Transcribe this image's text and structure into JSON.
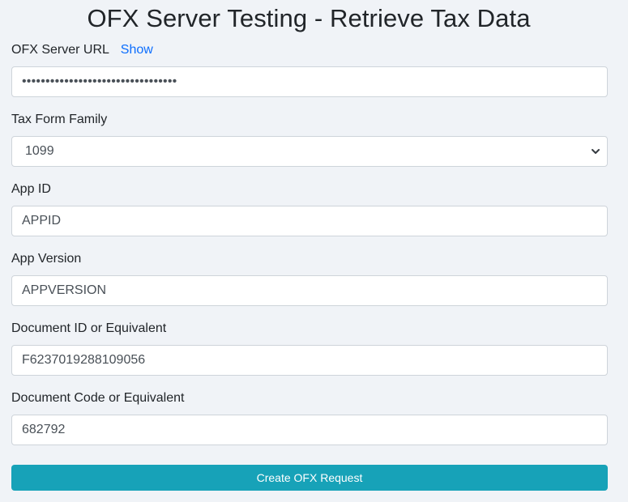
{
  "page": {
    "title": "OFX Server Testing - Retrieve Tax Data"
  },
  "form": {
    "server_url": {
      "label": "OFX Server URL",
      "toggle_label": "Show",
      "value": "•••••••••••••••••••••••••••••••••"
    },
    "tax_form_family": {
      "label": "Tax Form Family",
      "selected": "1099"
    },
    "app_id": {
      "label": "App ID",
      "value": "APPID"
    },
    "app_version": {
      "label": "App Version",
      "value": "APPVERSION"
    },
    "document_id": {
      "label": "Document ID or Equivalent",
      "value": "F6237019288109056"
    },
    "document_code": {
      "label": "Document Code or Equivalent",
      "value": "682792"
    },
    "submit_label": "Create OFX Request"
  },
  "colors": {
    "page_background": "#f0f3f7",
    "link": "#0d6efd",
    "button": "#17a2b8",
    "button_text": "#ffffff",
    "field_border": "#ced4da"
  }
}
